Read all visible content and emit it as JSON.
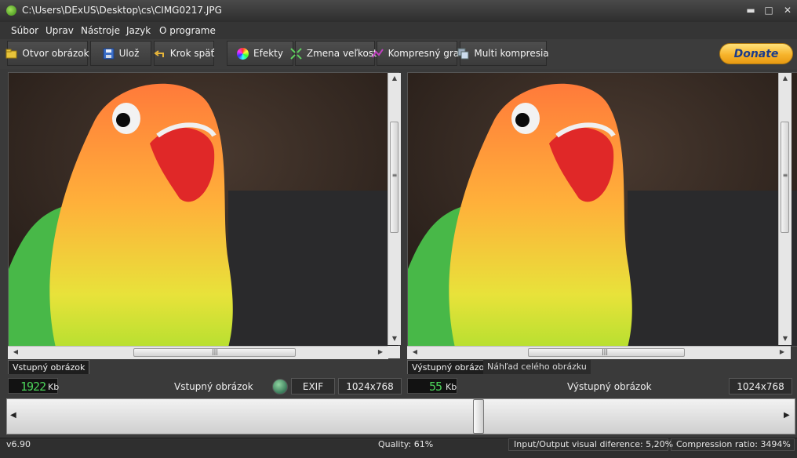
{
  "window": {
    "title": "C:\\Users\\DExUS\\Desktop\\cs\\CIMG0217.JPG",
    "minimize": "▬",
    "maximize": "□",
    "close": "✕"
  },
  "menu": [
    "Súbor",
    "Uprav",
    "Nástroje",
    "Jazyk",
    "O programe"
  ],
  "toolbar": {
    "open_label": "Otvor obrázok",
    "save_label": "Ulož",
    "undo_label": "Krok späť",
    "effects_label": "Efekty",
    "resize_label": "Zmena veľkosti",
    "graph_label": "Kompresný graf",
    "multi_label": "Multi kompresia",
    "donate_label": "Donate"
  },
  "left_panel": {
    "tab_label": "Vstupný obrázok",
    "size_value": "1922",
    "size_unit": "Kb",
    "caption": "Vstupný obrázok",
    "exif_label": "EXIF",
    "dimensions": "1024x768"
  },
  "right_panel": {
    "tab_label": "Výstupný obrázok",
    "tab2_label": "Náhľad celého obrázku",
    "size_value": "55",
    "size_unit": "Kb",
    "caption": "Výstupný obrázok",
    "dimensions": "1024x768"
  },
  "scroll": {
    "up": "▲",
    "down": "▼",
    "left": "◀",
    "right": "▶",
    "grip_v": "≡",
    "grip_h": "|||"
  },
  "slider": {
    "left_arrow": "◀",
    "right_arrow": "▶",
    "position_fraction": 0.6
  },
  "status": {
    "version": "v6.90",
    "quality": "Quality: 61%",
    "difference": "Input/Output visual diference: 5,20%",
    "ratio": "Compression ratio: 3494%"
  },
  "colors": {
    "segment_green": "#4cd45a",
    "donate_gold": "#f7b42c"
  }
}
